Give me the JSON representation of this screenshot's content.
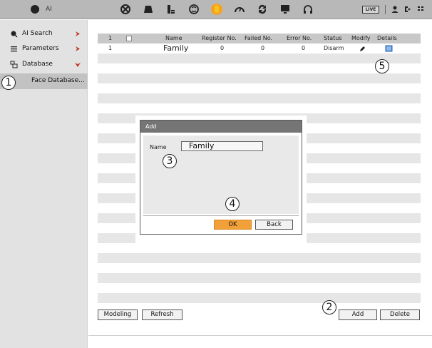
{
  "app": {
    "title": "AI"
  },
  "toolbar": {
    "icons": [
      "target-icon",
      "camera-icon",
      "storage-icon",
      "network-icon",
      "face-icon",
      "performance-icon",
      "sync-icon",
      "display-icon",
      "headset-icon"
    ],
    "active_icon": "face-icon",
    "live_label": "LIVE"
  },
  "sidebar": {
    "items": [
      {
        "label": "AI Search",
        "icon": "ai-search-icon"
      },
      {
        "label": "Parameters",
        "icon": "list-icon"
      },
      {
        "label": "Database",
        "icon": "database-icon"
      },
      {
        "label": "Face Database..."
      }
    ]
  },
  "table": {
    "header": {
      "index": "1",
      "name": "Name",
      "register_no": "Register No.",
      "failed_no": "Failed No.",
      "error_no": "Error No.",
      "status": "Status",
      "modify": "Modify",
      "details": "Details"
    },
    "rows": [
      {
        "index": "1",
        "name": "Family",
        "register_no": "0",
        "failed_no": "0",
        "error_no": "0",
        "status": "Disarm"
      }
    ]
  },
  "buttons": {
    "modeling": "Modeling",
    "refresh": "Refresh",
    "add": "Add",
    "delete": "Delete"
  },
  "dialog": {
    "title": "Add",
    "name_label": "Name",
    "name_value": "Family",
    "ok": "OK",
    "back": "Back"
  },
  "callouts": {
    "c1": "1",
    "c2": "2",
    "c3": "3",
    "c4": "4",
    "c5": "5"
  },
  "colors": {
    "accent": "#f6a21e",
    "ok_button": "#f2a03a",
    "topbar": "#b8b8b8",
    "dialog_title": "#757575",
    "arrow": "#c0392b"
  }
}
